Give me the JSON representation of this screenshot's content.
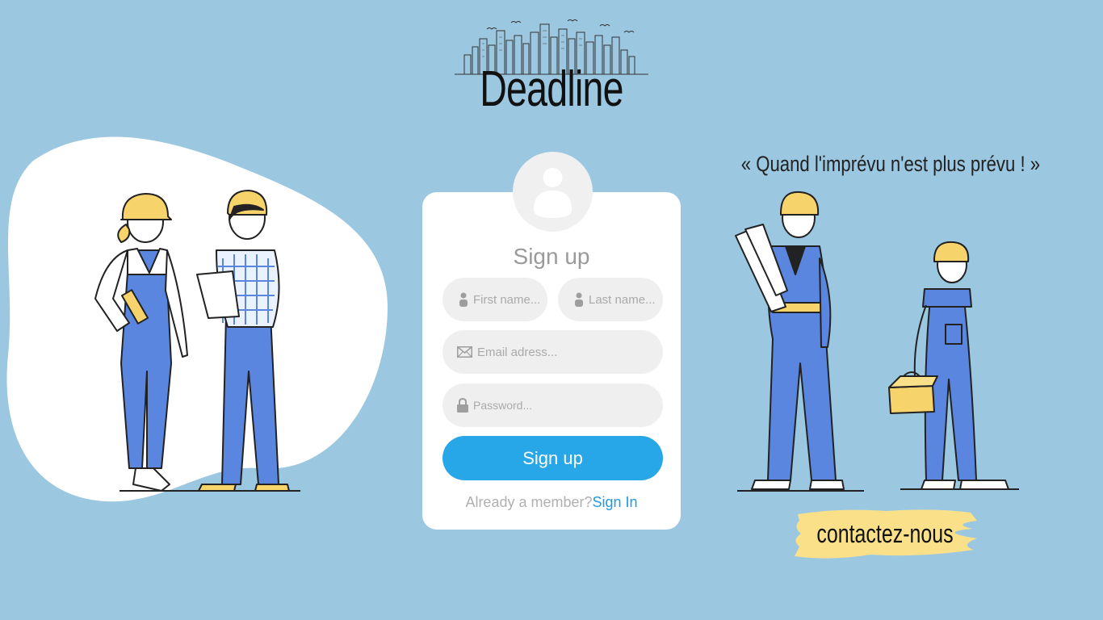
{
  "brand": {
    "name": "Deadline"
  },
  "tagline": "« Quand l'imprévu n'est plus prévu ! »",
  "form": {
    "title": "Sign up",
    "first_name_placeholder": "First name...",
    "last_name_placeholder": "Last name...",
    "email_placeholder": "Email adress...",
    "password_placeholder": "Password...",
    "submit_label": "Sign up",
    "member_text": "Already a member?",
    "signin_link": "Sign In"
  },
  "contact": {
    "label": "contactez-nous"
  },
  "icons": {
    "user": "user-icon",
    "email": "envelope-icon",
    "password": "lock-icon",
    "avatar": "avatar-icon"
  },
  "colors": {
    "background": "#9bc8e0",
    "primary_button": "#27a6e8",
    "link": "#1c9be3",
    "card": "#ffffff",
    "highlight": "#fbe08a",
    "overall_blue": "#5a86e0",
    "helmet_yellow": "#f7d36b"
  }
}
